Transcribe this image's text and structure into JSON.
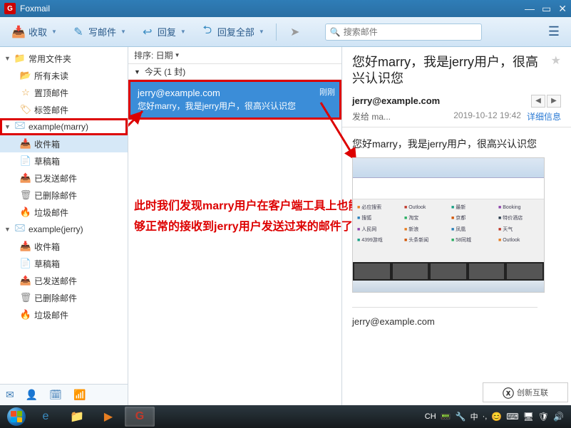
{
  "titlebar": {
    "app_name": "Foxmail"
  },
  "toolbar": {
    "receive": "收取",
    "compose": "写邮件",
    "reply": "回复",
    "reply_all": "回复全部",
    "search_placeholder": "搜索邮件"
  },
  "folders": {
    "common": {
      "label": "常用文件夹",
      "unread": "所有未读",
      "pinned": "置顶邮件",
      "tagged": "标签邮件"
    },
    "acct1": {
      "label": "example(marry)",
      "inbox": "收件箱",
      "drafts": "草稿箱",
      "sent": "已发送邮件",
      "trash": "已删除邮件",
      "junk": "垃圾邮件"
    },
    "acct2": {
      "label": "example(jerry)",
      "inbox": "收件箱",
      "drafts": "草稿箱",
      "sent": "已发送邮件",
      "trash": "已删除邮件",
      "junk": "垃圾邮件"
    }
  },
  "msglist": {
    "sort_label": "排序: 日期",
    "group_today": "今天 (1 封)",
    "item": {
      "from": "jerry@example.com",
      "subject": "您好marry，我是jerry用户，很高兴认识您",
      "time": "刚刚"
    }
  },
  "annotation": {
    "line1": "此时我们发现marry用户在客户端工具上也能",
    "line2": "够正常的接收到jerry用户发送过来的邮件了"
  },
  "preview": {
    "subject": "您好marry，我是jerry用户，很高兴认识您",
    "from": "jerry@example.com",
    "to_label": "发给 ma...",
    "date": "2019-10-12 19:42",
    "detail": "详细信息",
    "body": "您好marry，我是jerry用户，很高兴认识您",
    "signature": "jerry@example.com"
  },
  "taskbar": {
    "ime": "CH",
    "ime_text": "中",
    "watermark": "创新互联"
  }
}
